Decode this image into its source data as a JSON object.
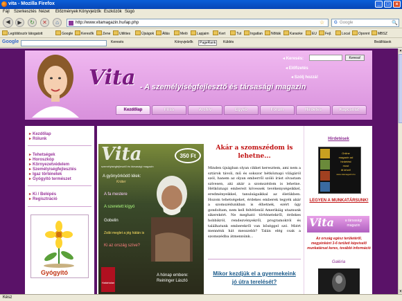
{
  "window": {
    "title": "vita - Mozilla Firefox"
  },
  "menu": [
    "Fájl",
    "Szerkesztés",
    "Nézet",
    "Előzmények",
    "Könyvjelzők",
    "Eszközök",
    "Súgó"
  ],
  "toolbar": {
    "url": "http://www.vitamagazin.hu/lap.php",
    "search_placeholder": "Google"
  },
  "bookmarks": [
    "Legtöbbször látogatott",
    "Google",
    "Keresők",
    "Zene",
    "Utilities",
    "Újságok",
    "Állás",
    "Meló",
    "Lapjaim",
    "Kert",
    "Tut",
    "Ingatlan",
    "Nőiták",
    "Karaoke",
    "EU",
    "Fejl.",
    "Local",
    "Oponnt",
    "MBSZ"
  ],
  "google_bar": {
    "label": "Google",
    "items": [
      "Keresés",
      "Könyvjelzők",
      "PageRank",
      "Küldés"
    ],
    "settings": "Beállítások"
  },
  "header": {
    "search_label": "Keresés:",
    "search_button": "Keress!",
    "links": [
      "Előfizetés",
      "Szólj hozzá!"
    ],
    "logo": "Vita",
    "tagline": "- A személyiségfejlesztő és társasági magazin",
    "tabs": [
      "Kezdőlap",
      "Friss",
      "Archív",
      "Egyéb",
      "Fórum",
      "Hirdetés",
      "Kapcsolat"
    ]
  },
  "left_links": {
    "group1": [
      "Kezdőlap",
      "Rólunk"
    ],
    "group2": [
      "Tehetségek",
      "Horoszkóp",
      "Környezetvédelem",
      "Személyiségfejlesztés",
      "Igaz történetek",
      "Gyógyító természet"
    ],
    "group3": [
      "Ki / Belépés",
      "Regisztráció"
    ],
    "promo": "Gyógyító"
  },
  "cover": {
    "logo": "Vita",
    "subtitle": "személyiségfejlesztő és társasági magazin",
    "price": "350 Ft",
    "lines": [
      "A gyönyörködő lélek:",
      "Kráter",
      "A fa mestere",
      "A szeretett kígyó",
      "Gobelin",
      "Zsibi meglet a jég hátán is",
      "Ki az ország szíve?"
    ],
    "caption": "A hónap embere: Reininger László",
    "badge": "Határtalan"
  },
  "article": {
    "title": "Akár a szomszédom is lehetne...",
    "body": "Minden újságban olyan cikket keresztem, ami nem a sztárok távoli, mű és sokszor hétköznapi világáról szól, hanem az olyan emberről szóló írást olvastam szívesen, aki akár a szomszédom is lehetne. Hétköznapi embereit kövessek tevékenységeikkel, eredményeikkel, tanulságaikkal az életükben. Hozom tehetségeket, érdekes emberek tegyék akár a szomszédunkban is élhetnek, ezért úgy gondoltam, nem kell feltétlenül Amerikáig utaznunk sikerekért. Ne megható történetekről, érdekes hobbikról, rendezvényekről, programokról és találhatunk emberekről van bőséggel szó. Miért mennénk hát messzebb? Talán elég csak a szomszédba átmennünk...",
    "title2": "Mikor kezdjük el a gyermekeink jó útra terelését?"
  },
  "right": {
    "ads_title": "Hirdetések",
    "ad_lines": [
      "Online",
      "magazin ad",
      "hirdetést",
      "most",
      "itt lehet!",
      "www.vitamagazin.hu"
    ],
    "worker_link": "LEGYEN A MUNKATÁRSUNK!",
    "logo": "Vita",
    "logo_sub": "a társasági magazin",
    "promo_text": "Az ország egész területéről, megyénként 3-6 területi képviselő munkatársat keres, további információ",
    "gallery_title": "Galéria"
  },
  "status": "Kész"
}
